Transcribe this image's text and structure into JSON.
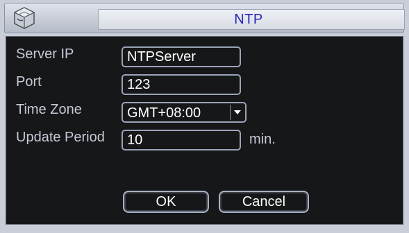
{
  "window": {
    "title": "NTP",
    "logo_icon": "cube-logo-icon"
  },
  "form": {
    "server_ip": {
      "label": "Server IP",
      "value": "NTPServer"
    },
    "port": {
      "label": "Port",
      "value": "123"
    },
    "time_zone": {
      "label": "Time Zone",
      "value": "GMT+08:00",
      "icon": "chevron-down-icon"
    },
    "update_period": {
      "label": "Update Period",
      "value": "10",
      "unit": "min."
    }
  },
  "buttons": {
    "ok_label": "OK",
    "cancel_label": "Cancel"
  },
  "colors": {
    "title_text": "#2a25b8",
    "panel_bg": "#161718",
    "label_text": "#c5cad6",
    "field_border": "#9aa4b8"
  }
}
